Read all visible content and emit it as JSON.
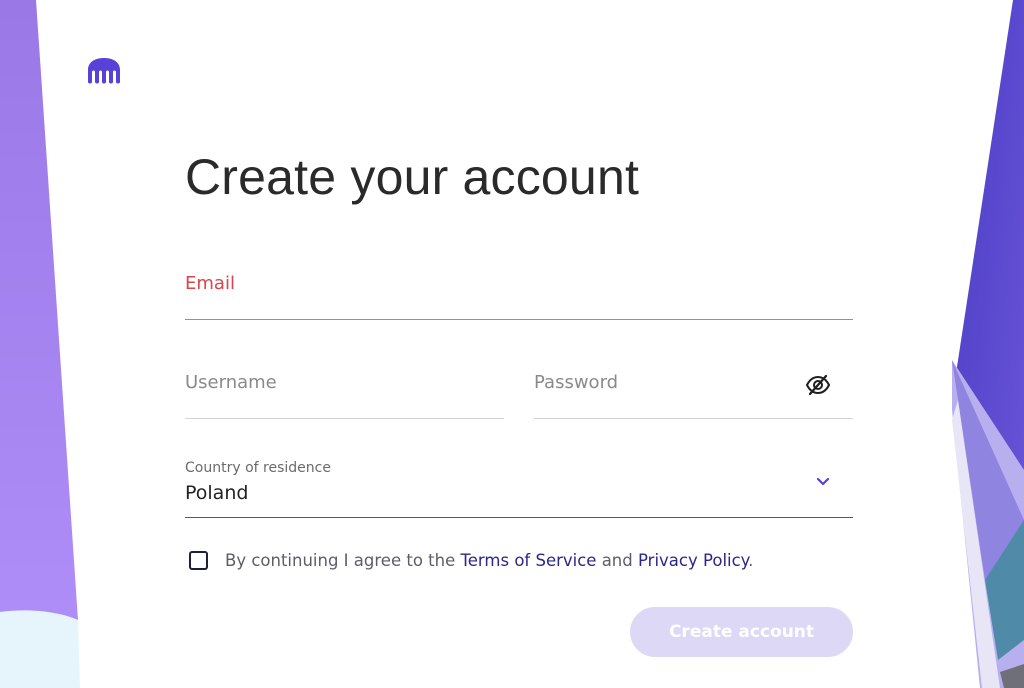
{
  "page": {
    "title": "Create your account"
  },
  "brand": {
    "logo_icon": "kraken-logo-icon",
    "accent_color": "#5741d9"
  },
  "form": {
    "email": {
      "label": "Email",
      "value": "",
      "state": "error"
    },
    "username": {
      "label": "Username",
      "value": ""
    },
    "password": {
      "label": "Password",
      "value": "",
      "toggle_icon": "eye-off-icon"
    },
    "country": {
      "label": "Country of residence",
      "value": "Poland",
      "dropdown_icon": "chevron-down-icon"
    },
    "terms": {
      "checked": false,
      "prefix": "By continuing I agree to the ",
      "terms_link": "Terms of Service",
      "and": " and ",
      "privacy_link": "Privacy Policy",
      "suffix": "."
    },
    "submit_label": "Create account"
  },
  "colors": {
    "error": "#d9444a",
    "link": "#2b2788",
    "button_disabled": "#dcd8f6"
  }
}
